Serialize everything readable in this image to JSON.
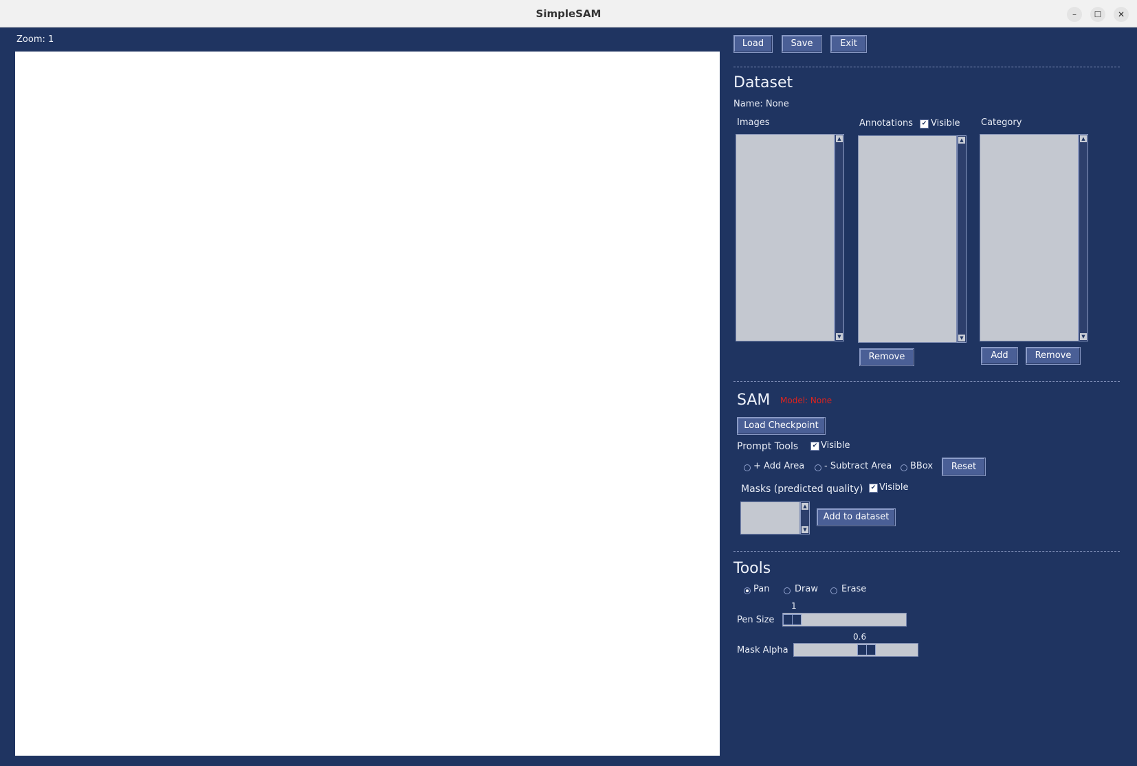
{
  "window": {
    "title": "SimpleSAM",
    "minimize": "–",
    "maximize": "☐",
    "close": "✕"
  },
  "zoom_label": "Zoom: 1",
  "toolbar": {
    "load": "Load",
    "save": "Save",
    "exit": "Exit"
  },
  "dataset": {
    "heading": "Dataset",
    "name": "Name: None",
    "images_label": "Images",
    "annotations_label": "Annotations",
    "annotations_visible": "Visible",
    "category_label": "Category",
    "remove_annotation": "Remove",
    "add_category": "Add",
    "remove_category": "Remove"
  },
  "sam": {
    "heading": "SAM",
    "model_status": "Model: None",
    "model_status_color": "#e0231c",
    "load_checkpoint": "Load Checkpoint",
    "prompt_tools_label": "Prompt Tools",
    "prompt_visible": "Visible",
    "add_area": "+ Add Area",
    "subtract_area": "- Subtract Area",
    "bbox": "BBox",
    "reset": "Reset",
    "masks_label": "Masks (predicted quality)",
    "masks_visible": "Visible",
    "add_to_dataset": "Add to dataset"
  },
  "tools": {
    "heading": "Tools",
    "pan": "Pan",
    "draw": "Draw",
    "erase": "Erase",
    "selected_tool": "Pan",
    "pen_size_label": "Pen Size",
    "pen_size_value": "1",
    "pen_size_fraction": 0.0,
    "mask_alpha_label": "Mask Alpha",
    "mask_alpha_value": "0.6",
    "mask_alpha_fraction": 0.6
  },
  "colors": {
    "background": "#1f3461",
    "button": "#4a5f96",
    "listbox": "#c4c8d0"
  }
}
